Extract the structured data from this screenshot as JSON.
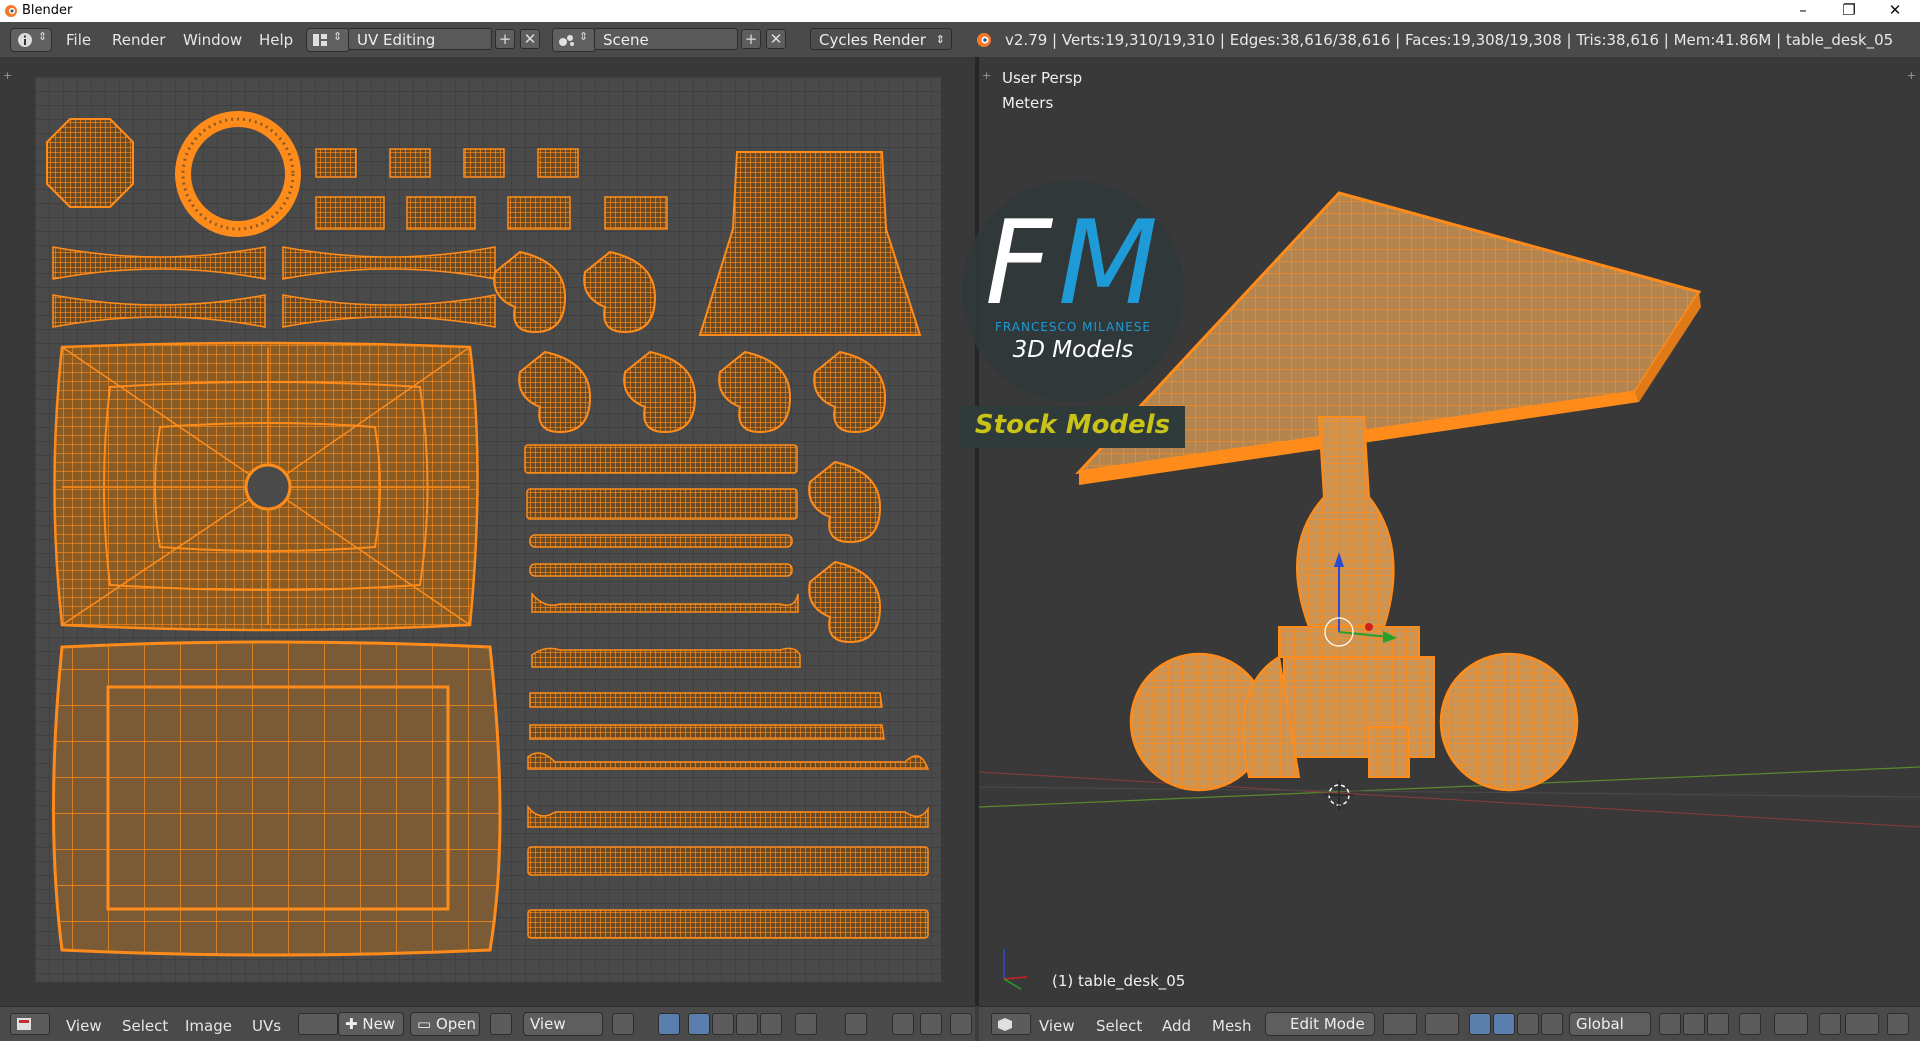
{
  "window": {
    "title": "Blender",
    "minimize": "–",
    "maximize": "❐",
    "close": "✕"
  },
  "info_header": {
    "menus": [
      "File",
      "Render",
      "Window",
      "Help"
    ],
    "screen_layout": "UV Editing",
    "scene": "Scene",
    "render_engine": "Cycles Render",
    "stats": "v2.79 | Verts:19,310/19,310 | Edges:38,616/38,616 | Faces:19,308/19,308 | Tris:38,616 | Mem:41.86M | table_desk_05",
    "add_symbol": "+",
    "remove_symbol": "✕"
  },
  "viewport": {
    "view_name": "User Persp",
    "units": "Meters",
    "object_label": "(1) table_desk_05"
  },
  "uv_footer": {
    "menus": [
      "View",
      "Select",
      "Image",
      "UVs"
    ],
    "new_label": "New",
    "open_label": "Open",
    "view_label": "View"
  },
  "viewport_footer": {
    "menus": [
      "View",
      "Select",
      "Add",
      "Mesh"
    ],
    "mode": "Edit Mode",
    "orientation": "Global"
  },
  "watermark": {
    "logo_left": "F",
    "logo_right": "M",
    "name": "FRANCESCO MILANESE",
    "tagline": "3D Models",
    "banner": "Stock Models"
  },
  "colors": {
    "wire": "#ff8c1a",
    "background": "#393939",
    "uv_grid": "#4a4a4a",
    "brand_blue": "#1e9ad6",
    "banner_text": "#c8c219"
  }
}
